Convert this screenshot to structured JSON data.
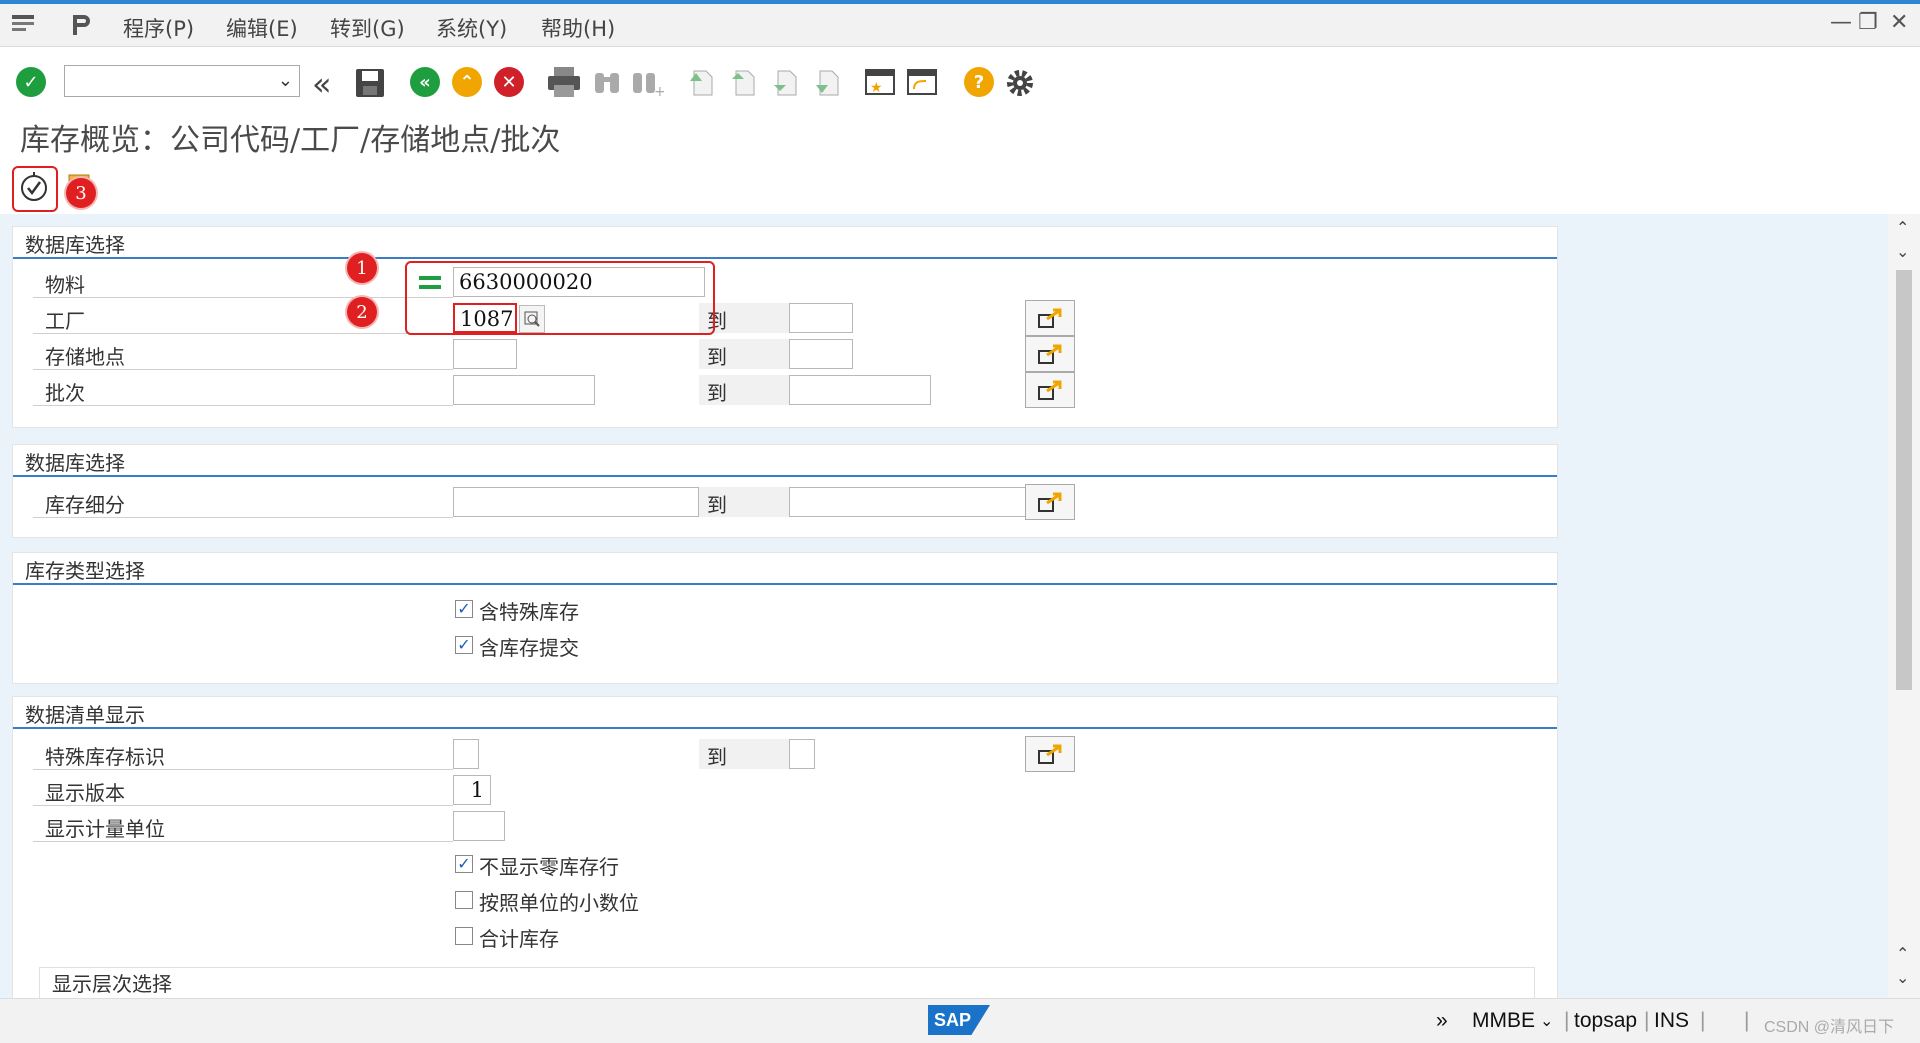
{
  "menu": {
    "items": [
      "程序(P)",
      "编辑(E)",
      "转到(G)",
      "系统(Y)",
      "帮助(H)"
    ]
  },
  "toolbar": {
    "command_value": "",
    "icons": [
      "enter-icon",
      "back-nav-icon",
      "save-icon",
      "back-icon",
      "exit-icon",
      "cancel-icon",
      "print-icon",
      "find-icon",
      "find-next-icon",
      "first-page-icon",
      "previous-page-icon",
      "next-page-icon",
      "last-page-icon",
      "new-session-icon",
      "shortcut-icon",
      "help-icon",
      "settings-icon"
    ]
  },
  "title": "库存概览：公司代码/工厂/存储地点/批次",
  "panels": {
    "db_selection": {
      "title": "数据库选择",
      "rows": [
        {
          "label": "物料",
          "low": "6630000020",
          "high": ""
        },
        {
          "label": "工厂",
          "low": "1087",
          "high": ""
        },
        {
          "label": "存储地点",
          "low": "",
          "high": ""
        },
        {
          "label": "批次",
          "low": "",
          "high": ""
        }
      ],
      "to_label": "到"
    },
    "db_selection2": {
      "title": "数据库选择",
      "rows": [
        {
          "label": "库存细分",
          "low": "",
          "high": ""
        }
      ],
      "to_label": "到"
    },
    "stock_type": {
      "title": "库存类型选择",
      "checkboxes": [
        {
          "label": "含特殊库存",
          "checked": true
        },
        {
          "label": "含库存提交",
          "checked": true
        }
      ]
    },
    "list_display": {
      "title": "数据清单显示",
      "rows": [
        {
          "label": "特殊库存标识",
          "low": "",
          "high": ""
        },
        {
          "label": "显示版本",
          "low": "1"
        },
        {
          "label": "显示计量单位",
          "low": ""
        }
      ],
      "to_label": "到",
      "checkboxes": [
        {
          "label": "不显示零库存行",
          "checked": true
        },
        {
          "label": "按照单位的小数位",
          "checked": false
        },
        {
          "label": "合计库存",
          "checked": false
        }
      ],
      "cut_title": "显示层次选择"
    }
  },
  "annotations": {
    "badge1": "1",
    "badge2": "2",
    "badge3": "3"
  },
  "status": {
    "logo": "SAP",
    "expand": "»",
    "tcode": "MMBE",
    "server": "topsap",
    "mode": "INS",
    "watermark": "CSDN @清风日下"
  },
  "colors": {
    "accent": "#2d86d4",
    "annotation_red": "#e02020",
    "enter_green": "#1e9e3e",
    "content_bg": "#eaf2fa",
    "help_orange": "#f0a500"
  }
}
